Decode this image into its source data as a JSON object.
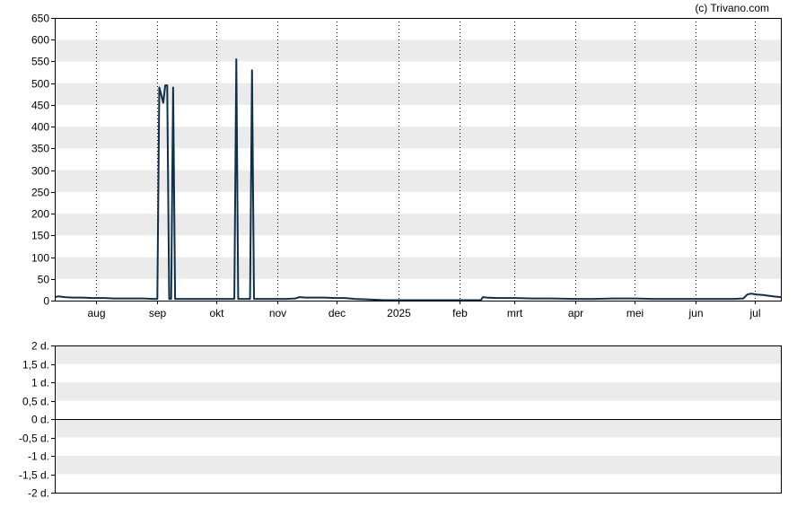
{
  "credit": "(c) Trivano.com",
  "colors": {
    "line": "#0f3049",
    "band": "#ebebeb",
    "frame": "#000000",
    "vgrid": "#000000"
  },
  "chart_data": [
    {
      "type": "line",
      "title": "",
      "xlabel": "",
      "ylabel": "",
      "ylim": [
        0,
        650
      ],
      "y_ticks": [
        "0",
        "50",
        "100",
        "150",
        "200",
        "250",
        "300",
        "350",
        "400",
        "450",
        "500",
        "550",
        "600",
        "650"
      ],
      "x_range": [
        "2024-07-11",
        "2025-07-14"
      ],
      "x_ticks": [
        {
          "date": "2024-08-01",
          "label": "aug"
        },
        {
          "date": "2024-09-01",
          "label": "sep"
        },
        {
          "date": "2024-10-01",
          "label": "okt"
        },
        {
          "date": "2024-11-01",
          "label": "nov"
        },
        {
          "date": "2024-12-01",
          "label": "dec"
        },
        {
          "date": "2025-01-01",
          "label": "2025"
        },
        {
          "date": "2025-02-01",
          "label": "feb"
        },
        {
          "date": "2025-03-01",
          "label": "mrt"
        },
        {
          "date": "2025-04-01",
          "label": "apr"
        },
        {
          "date": "2025-05-01",
          "label": "mei"
        },
        {
          "date": "2025-06-01",
          "label": "jun"
        },
        {
          "date": "2025-07-01",
          "label": "jul"
        }
      ],
      "grid": "alternating horizontal bands, dotted vertical month lines",
      "series": [
        {
          "color": "#0f3049",
          "points": [
            [
              "2024-07-11",
              8
            ],
            [
              "2024-07-13",
              10
            ],
            [
              "2024-07-16",
              8
            ],
            [
              "2024-07-20",
              7
            ],
            [
              "2024-07-25",
              7
            ],
            [
              "2024-07-30",
              6
            ],
            [
              "2024-08-05",
              6
            ],
            [
              "2024-08-10",
              5
            ],
            [
              "2024-08-15",
              5
            ],
            [
              "2024-08-20",
              5
            ],
            [
              "2024-08-25",
              5
            ],
            [
              "2024-08-30",
              4
            ],
            [
              "2024-09-01",
              4
            ],
            [
              "2024-09-02",
              490
            ],
            [
              "2024-09-04",
              455
            ],
            [
              "2024-09-05",
              495
            ],
            [
              "2024-09-06",
              495
            ],
            [
              "2024-09-07",
              4
            ],
            [
              "2024-09-08",
              4
            ],
            [
              "2024-09-09",
              490
            ],
            [
              "2024-09-10",
              4
            ],
            [
              "2024-09-15",
              4
            ],
            [
              "2024-09-20",
              4
            ],
            [
              "2024-09-25",
              4
            ],
            [
              "2024-09-30",
              4
            ],
            [
              "2024-10-05",
              4
            ],
            [
              "2024-10-10",
              4
            ],
            [
              "2024-10-11",
              555
            ],
            [
              "2024-10-12",
              4
            ],
            [
              "2024-10-15",
              4
            ],
            [
              "2024-10-18",
              4
            ],
            [
              "2024-10-19",
              530
            ],
            [
              "2024-10-20",
              4
            ],
            [
              "2024-10-25",
              4
            ],
            [
              "2024-10-30",
              4
            ],
            [
              "2024-11-05",
              4
            ],
            [
              "2024-11-10",
              5
            ],
            [
              "2024-11-12",
              8
            ],
            [
              "2024-11-15",
              7
            ],
            [
              "2024-11-20",
              7
            ],
            [
              "2024-11-25",
              7
            ],
            [
              "2024-11-30",
              6
            ],
            [
              "2024-12-05",
              6
            ],
            [
              "2024-12-10",
              4
            ],
            [
              "2024-12-15",
              3
            ],
            [
              "2024-12-20",
              2
            ],
            [
              "2024-12-25",
              1
            ],
            [
              "2025-01-01",
              1
            ],
            [
              "2025-01-10",
              1
            ],
            [
              "2025-01-20",
              1
            ],
            [
              "2025-01-31",
              1
            ],
            [
              "2025-02-10",
              1
            ],
            [
              "2025-02-12",
              1
            ],
            [
              "2025-02-13",
              8
            ],
            [
              "2025-02-15",
              7
            ],
            [
              "2025-02-20",
              6
            ],
            [
              "2025-03-01",
              6
            ],
            [
              "2025-03-10",
              5
            ],
            [
              "2025-03-20",
              5
            ],
            [
              "2025-04-01",
              4
            ],
            [
              "2025-04-10",
              4
            ],
            [
              "2025-04-20",
              5
            ],
            [
              "2025-05-01",
              5
            ],
            [
              "2025-05-10",
              4
            ],
            [
              "2025-05-20",
              4
            ],
            [
              "2025-06-01",
              4
            ],
            [
              "2025-06-10",
              4
            ],
            [
              "2025-06-20",
              4
            ],
            [
              "2025-06-25",
              5
            ],
            [
              "2025-06-27",
              14
            ],
            [
              "2025-06-29",
              16
            ],
            [
              "2025-07-02",
              14
            ],
            [
              "2025-07-05",
              13
            ],
            [
              "2025-07-10",
              10
            ],
            [
              "2025-07-14",
              8
            ]
          ]
        }
      ]
    },
    {
      "type": "line",
      "title": "",
      "xlabel": "",
      "ylabel": "",
      "ylim": [
        -2,
        2
      ],
      "y_ticks": [
        "2 d.",
        "1,5 d.",
        "1 d.",
        "0,5 d.",
        "0 d.",
        "-0,5 d.",
        "-1 d.",
        "-1,5 d.",
        "-2 d."
      ],
      "reference_line": 0,
      "series": []
    }
  ]
}
